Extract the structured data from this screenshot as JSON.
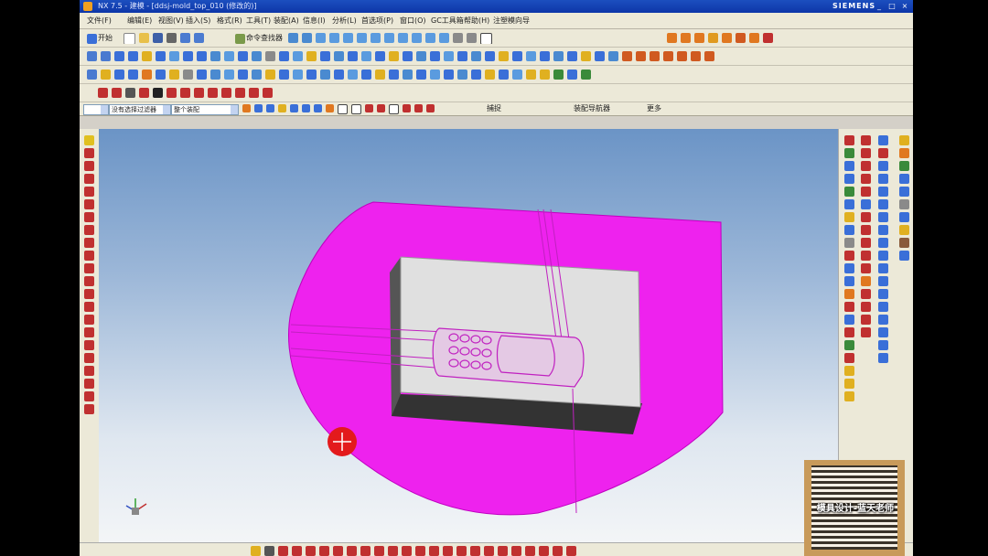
{
  "window": {
    "title": "NX 7.5 - 建模 - [ddsj-mold_top_010 (修改的)]",
    "brand": "SIEMENS",
    "controls": [
      "_",
      "□",
      "×"
    ]
  },
  "menubar": {
    "items": [
      "文件(F)",
      "编辑(E)",
      "视图(V)",
      "插入(S)",
      "格式(R)",
      "工具(T)",
      "装配(A)",
      "信息(I)",
      "分析(L)",
      "首选项(P)",
      "窗口(O)",
      "GC工具箱",
      "帮助(H)",
      "注塑模向导"
    ]
  },
  "toolbar1": {
    "start_label": "开始",
    "command_finder_label": "命令查找器"
  },
  "selection_bar": {
    "filter_value": "没有选择过滤器",
    "scope_value": "整个装配",
    "combo3_value": "",
    "snap_label": "捕捉",
    "assembly_label": "装配导航器",
    "more_label": "更多"
  },
  "colors": {
    "part_magenta": "#ee22ee",
    "block_face": "#e0e0e0",
    "cursor_marker": "#e31a1c"
  },
  "watermark": {
    "caption": "模具设计-蓝天老师"
  },
  "icons": [
    "start-icon",
    "new-file-icon",
    "open-folder-icon",
    "save-icon",
    "cut-icon",
    "undo-icon",
    "redo-icon",
    "zoom-icon",
    "rotate-icon",
    "view-cube-icon",
    "line-icon",
    "arc-icon",
    "circle-icon",
    "point-icon",
    "sketch-icon",
    "mold-wizard-icon",
    "qr-code-icon",
    "wcs-triad-icon"
  ]
}
